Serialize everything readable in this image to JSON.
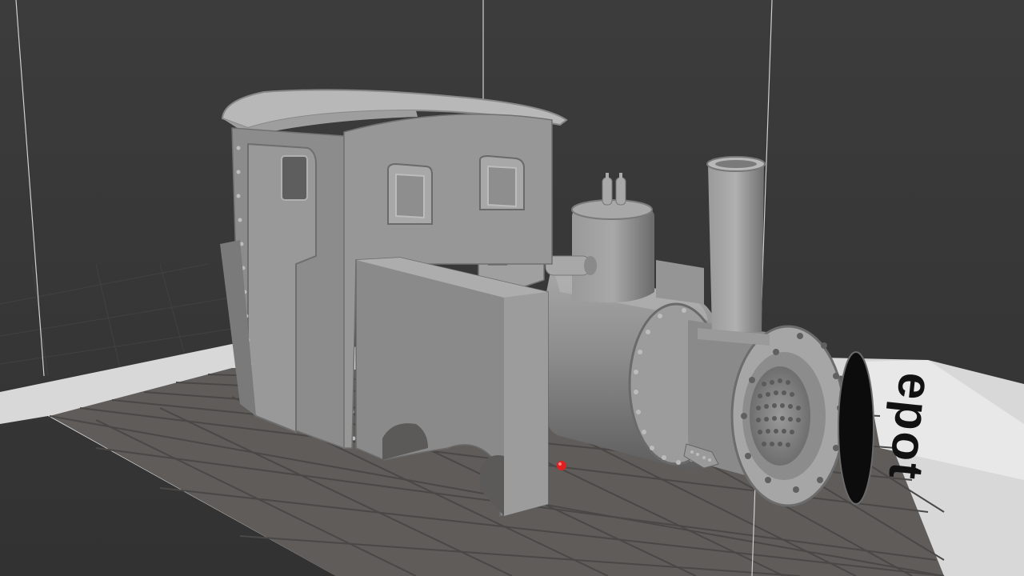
{
  "viewport": {
    "background_color": "#3a3a3a",
    "grid_color": "#5c5a58",
    "model_color": "#8a8a8a"
  },
  "build_plate": {
    "label": "epot",
    "label_color": "#111111"
  },
  "origin_marker": {
    "color": "#e02020"
  }
}
